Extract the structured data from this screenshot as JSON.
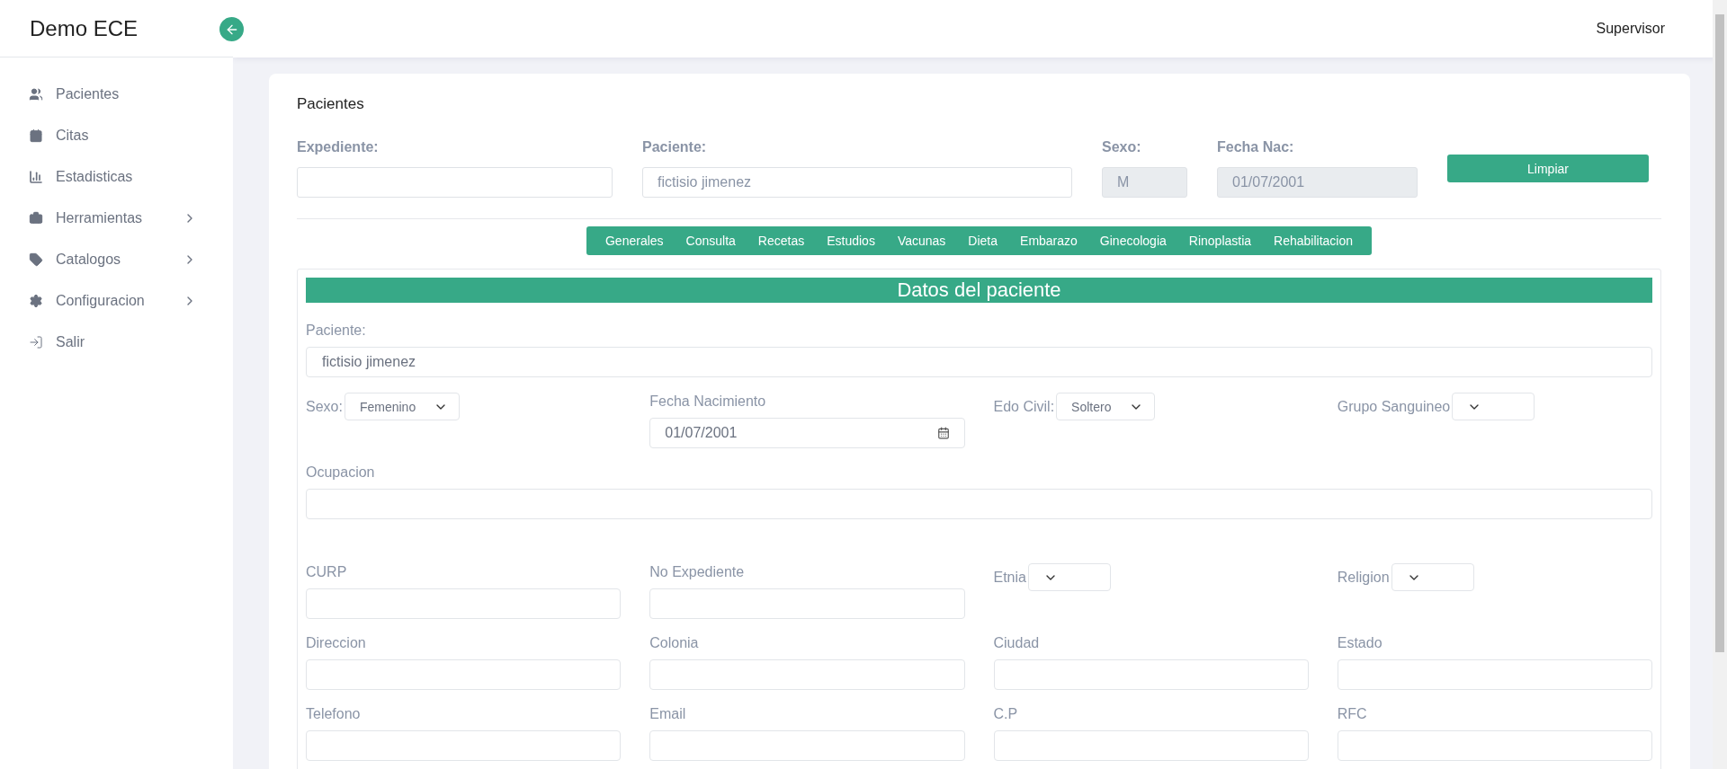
{
  "sidebar": {
    "brand": "Demo ECE",
    "items": [
      {
        "label": "Pacientes",
        "expandable": false
      },
      {
        "label": "Citas",
        "expandable": false
      },
      {
        "label": "Estadisticas",
        "expandable": false
      },
      {
        "label": "Herramientas",
        "expandable": true
      },
      {
        "label": "Catalogos",
        "expandable": true
      },
      {
        "label": "Configuracion",
        "expandable": true
      },
      {
        "label": "Salir",
        "expandable": false
      }
    ]
  },
  "topbar": {
    "user": "Supervisor"
  },
  "card": {
    "title": "Pacientes",
    "search_fields": [
      {
        "label": "Expediente:",
        "readonly": false
      },
      {
        "label": "Paciente:",
        "value": "fictisio jimenez",
        "readonly": false
      },
      {
        "label": "Sexo:",
        "value": "M",
        "readonly": true
      },
      {
        "label": "Fecha Nac:",
        "value": "01/07/2001",
        "readonly": true
      }
    ],
    "clear_button": "Limpiar",
    "tabs": [
      "Generales",
      "Consulta",
      "Recetas",
      "Estudios",
      "Vacunas",
      "Dieta",
      "Embarazo",
      "Ginecologia",
      "Rinoplastia",
      "Rehabilitacion"
    ],
    "section": {
      "title": "Datos del paciente",
      "fields": [
        {
          "kind": "wide",
          "label": "Paciente:",
          "value": "fictisio jimenez"
        },
        {
          "kind": "select",
          "label": "Sexo:",
          "value": "Femenino"
        },
        {
          "kind": "date",
          "label": "Fecha Nacimiento",
          "value": "01/07/2001"
        },
        {
          "kind": "select",
          "label": "Edo Civil:",
          "value": "Soltero"
        },
        {
          "kind": "select",
          "label": "Grupo Sanguineo"
        },
        {
          "kind": "wide",
          "label": "Ocupacion"
        },
        {
          "kind": "text",
          "label": "CURP"
        },
        {
          "kind": "text",
          "label": "No Expediente"
        },
        {
          "kind": "select",
          "label": "Etnia"
        },
        {
          "kind": "select",
          "label": "Religion"
        },
        {
          "kind": "text",
          "label": "Direccion"
        },
        {
          "kind": "text",
          "label": "Colonia"
        },
        {
          "kind": "text",
          "label": "Ciudad"
        },
        {
          "kind": "text",
          "label": "Estado"
        },
        {
          "kind": "text",
          "label": "Telefono"
        },
        {
          "kind": "text",
          "label": "Email"
        },
        {
          "kind": "text",
          "label": "C.P"
        },
        {
          "kind": "text",
          "label": "RFC"
        }
      ]
    }
  }
}
